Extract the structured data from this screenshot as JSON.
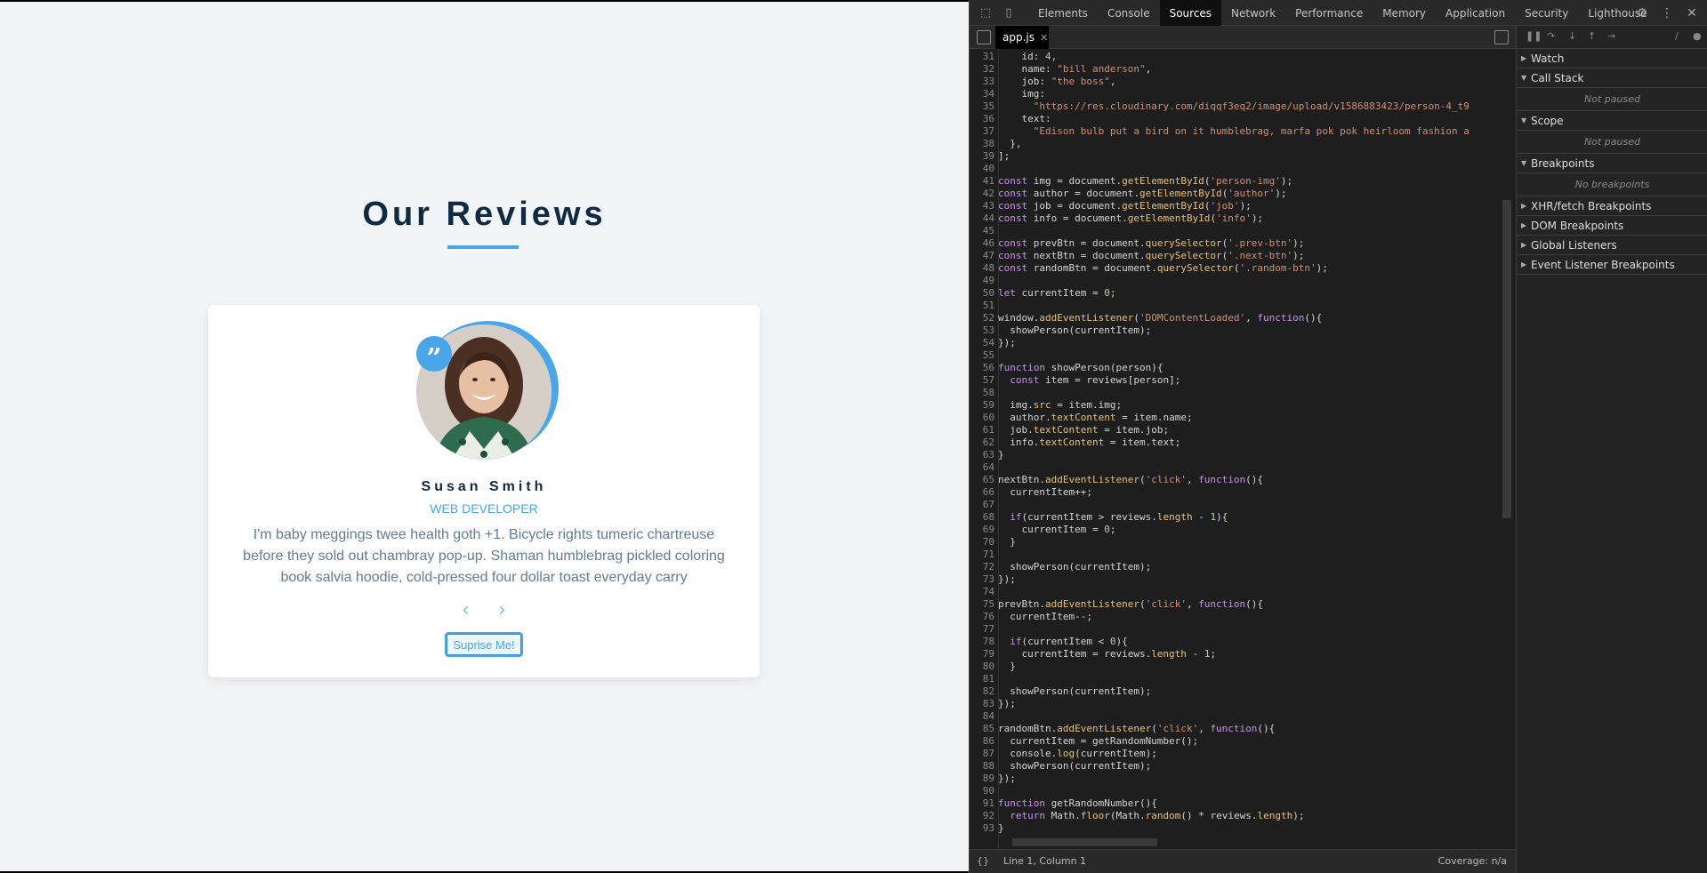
{
  "page": {
    "title": "Our Reviews",
    "review": {
      "quote_glyph": "”",
      "author": "Susan Smith",
      "job": "web developer",
      "text": "I'm baby meggings twee health goth +1. Bicycle rights tumeric chartreuse before they sold out chambray pop-up. Shaman humblebrag pickled coloring book salvia hoodie, cold-pressed four dollar toast everyday carry",
      "prev_icon": "‹",
      "next_icon": "›",
      "random_label": "Suprise Me!"
    }
  },
  "devtools": {
    "tabs": [
      "Elements",
      "Console",
      "Sources",
      "Network",
      "Performance",
      "Memory",
      "Application",
      "Security",
      "Lighthouse"
    ],
    "active_tab": "Sources",
    "file_tab": "app.js",
    "status": {
      "braces": "{}",
      "position": "Line 1, Column 1",
      "coverage": "Coverage: n/a"
    },
    "sidebar": {
      "watch": "Watch",
      "call_stack": "Call Stack",
      "call_stack_status": "Not paused",
      "scope": "Scope",
      "scope_status": "Not paused",
      "breakpoints": "Breakpoints",
      "breakpoints_status": "No breakpoints",
      "xhr": "XHR/fetch Breakpoints",
      "dom": "DOM Breakpoints",
      "global": "Global Listeners",
      "event": "Event Listener Breakpoints"
    },
    "code_lines": [
      {
        "n": "31",
        "t": "    id: 4,"
      },
      {
        "n": "32",
        "t": "    name: \"bill anderson\","
      },
      {
        "n": "33",
        "t": "    job: \"the boss\","
      },
      {
        "n": "34",
        "t": "    img:"
      },
      {
        "n": "35",
        "t": "      \"https://res.cloudinary.com/diqqf3eq2/image/upload/v1586883423/person-4_t9"
      },
      {
        "n": "36",
        "t": "    text:"
      },
      {
        "n": "37",
        "t": "      \"Edison bulb put a bird on it humblebrag, marfa pok pok heirloom fashion a"
      },
      {
        "n": "38",
        "t": "  },"
      },
      {
        "n": "39",
        "t": "];"
      },
      {
        "n": "40",
        "t": ""
      },
      {
        "n": "41",
        "t": "const img = document.getElementById('person-img');"
      },
      {
        "n": "42",
        "t": "const author = document.getElementById('author');"
      },
      {
        "n": "43",
        "t": "const job = document.getElementById('job');"
      },
      {
        "n": "44",
        "t": "const info = document.getElementById('info');"
      },
      {
        "n": "45",
        "t": ""
      },
      {
        "n": "46",
        "t": "const prevBtn = document.querySelector('.prev-btn');"
      },
      {
        "n": "47",
        "t": "const nextBtn = document.querySelector('.next-btn');"
      },
      {
        "n": "48",
        "t": "const randomBtn = document.querySelector('.random-btn');"
      },
      {
        "n": "49",
        "t": ""
      },
      {
        "n": "50",
        "t": "let currentItem = 0;"
      },
      {
        "n": "51",
        "t": ""
      },
      {
        "n": "52",
        "t": "window.addEventListener('DOMContentLoaded', function(){"
      },
      {
        "n": "53",
        "t": "  showPerson(currentItem);"
      },
      {
        "n": "54",
        "t": "});"
      },
      {
        "n": "55",
        "t": ""
      },
      {
        "n": "56",
        "t": "function showPerson(person){"
      },
      {
        "n": "57",
        "t": "  const item = reviews[person];"
      },
      {
        "n": "58",
        "t": ""
      },
      {
        "n": "59",
        "t": "  img.src = item.img;"
      },
      {
        "n": "60",
        "t": "  author.textContent = item.name;"
      },
      {
        "n": "61",
        "t": "  job.textContent = item.job;"
      },
      {
        "n": "62",
        "t": "  info.textContent = item.text;"
      },
      {
        "n": "63",
        "t": "}"
      },
      {
        "n": "64",
        "t": ""
      },
      {
        "n": "65",
        "t": "nextBtn.addEventListener('click', function(){"
      },
      {
        "n": "66",
        "t": "  currentItem++;"
      },
      {
        "n": "67",
        "t": ""
      },
      {
        "n": "68",
        "t": "  if(currentItem > reviews.length - 1){"
      },
      {
        "n": "69",
        "t": "    currentItem = 0;"
      },
      {
        "n": "70",
        "t": "  }"
      },
      {
        "n": "71",
        "t": ""
      },
      {
        "n": "72",
        "t": "  showPerson(currentItem);"
      },
      {
        "n": "73",
        "t": "});"
      },
      {
        "n": "74",
        "t": ""
      },
      {
        "n": "75",
        "t": "prevBtn.addEventListener('click', function(){"
      },
      {
        "n": "76",
        "t": "  currentItem--;"
      },
      {
        "n": "77",
        "t": ""
      },
      {
        "n": "78",
        "t": "  if(currentItem < 0){"
      },
      {
        "n": "79",
        "t": "    currentItem = reviews.length - 1;"
      },
      {
        "n": "80",
        "t": "  }"
      },
      {
        "n": "81",
        "t": ""
      },
      {
        "n": "82",
        "t": "  showPerson(currentItem);"
      },
      {
        "n": "83",
        "t": "});"
      },
      {
        "n": "84",
        "t": ""
      },
      {
        "n": "85",
        "t": "randomBtn.addEventListener('click', function(){"
      },
      {
        "n": "86",
        "t": "  currentItem = getRandomNumber();"
      },
      {
        "n": "87",
        "t": "  console.log(currentItem);"
      },
      {
        "n": "88",
        "t": "  showPerson(currentItem);"
      },
      {
        "n": "89",
        "t": "});"
      },
      {
        "n": "90",
        "t": ""
      },
      {
        "n": "91",
        "t": "function getRandomNumber(){"
      },
      {
        "n": "92",
        "t": "  return Math.floor(Math.random() * reviews.length);"
      },
      {
        "n": "93",
        "t": "}"
      }
    ]
  }
}
